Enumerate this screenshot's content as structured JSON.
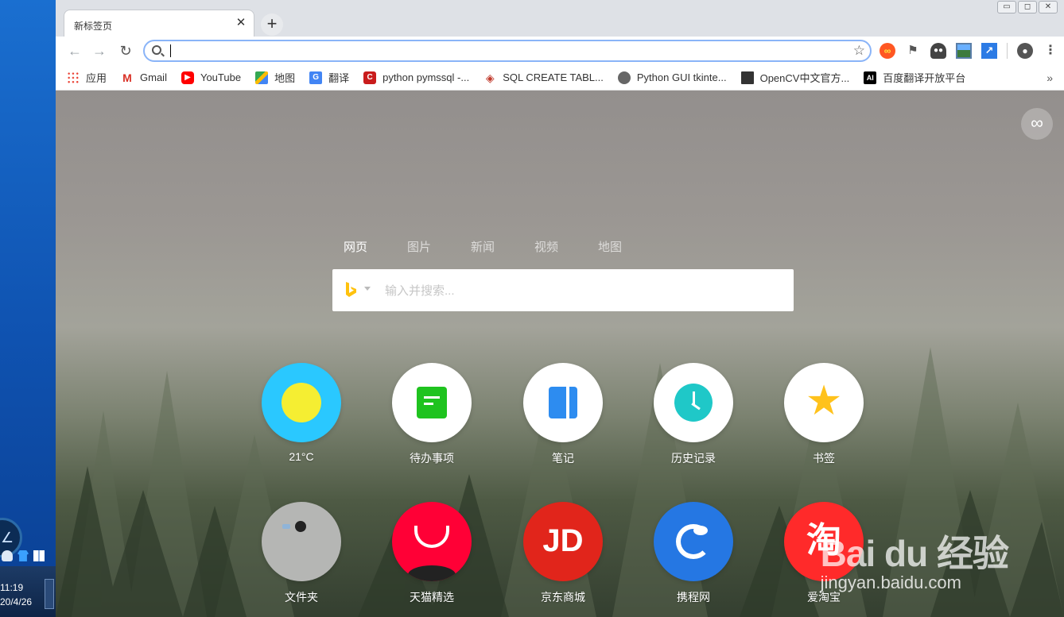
{
  "taskbar": {
    "time": "11:19",
    "date": "20/4/26"
  },
  "browser": {
    "tab_title": "新标签页",
    "tab_close": "✕",
    "new_tab": "+",
    "window_buttons": [
      "▭",
      "◻",
      "✕"
    ],
    "omnibox_value": "",
    "bookmarks": [
      {
        "label": "应用",
        "icon": "apps-icon"
      },
      {
        "label": "Gmail",
        "icon": "gmail-icon"
      },
      {
        "label": "YouTube",
        "icon": "youtube-icon"
      },
      {
        "label": "地图",
        "icon": "maps-icon"
      },
      {
        "label": "翻译",
        "icon": "translate-icon"
      },
      {
        "label": "python pymssql -...",
        "icon": "csdn-icon"
      },
      {
        "label": "SQL CREATE TABL...",
        "icon": "sql-icon"
      },
      {
        "label": "Python GUI tkinte...",
        "icon": "globe-icon"
      },
      {
        "label": "OpenCV中文官方...",
        "icon": "book-icon"
      },
      {
        "label": "百度翻译开放平台",
        "icon": "ai-icon"
      }
    ],
    "bookmarks_more": "»"
  },
  "ntp": {
    "search_tabs": [
      "网页",
      "图片",
      "新闻",
      "视频",
      "地图"
    ],
    "active_search_tab": "网页",
    "search_placeholder": "输入并搜索...",
    "infinity_label": "∞",
    "tiles": [
      {
        "label": "21°C",
        "icon": "weather-sun-icon",
        "color": "#2ac8ff"
      },
      {
        "label": "待办事项",
        "icon": "todo-icon",
        "color": "#1fc31f"
      },
      {
        "label": "笔记",
        "icon": "notes-icon",
        "color": "#2d8cf0"
      },
      {
        "label": "历史记录",
        "icon": "clock-icon",
        "color": "#1fc8c8"
      },
      {
        "label": "书签",
        "icon": "star-icon",
        "color": "#ffc21c"
      },
      {
        "label": "文件夹",
        "icon": "folder-icon",
        "color": "#b5b6b4"
      },
      {
        "label": "天猫精选",
        "icon": "tmall-icon",
        "color": "#ff0036"
      },
      {
        "label": "京东商城",
        "icon": "jd-icon",
        "color": "#e1251b"
      },
      {
        "label": "携程网",
        "icon": "ctrip-icon",
        "color": "#2577e3"
      },
      {
        "label": "爱淘宝",
        "icon": "taobao-icon",
        "color": "#ff2a2a"
      }
    ],
    "tile_glyphs": {
      "jd": "JD",
      "taobao": "淘"
    }
  },
  "watermark": {
    "main": "Bai du 经验",
    "sub": "jingyan.baidu.com"
  }
}
